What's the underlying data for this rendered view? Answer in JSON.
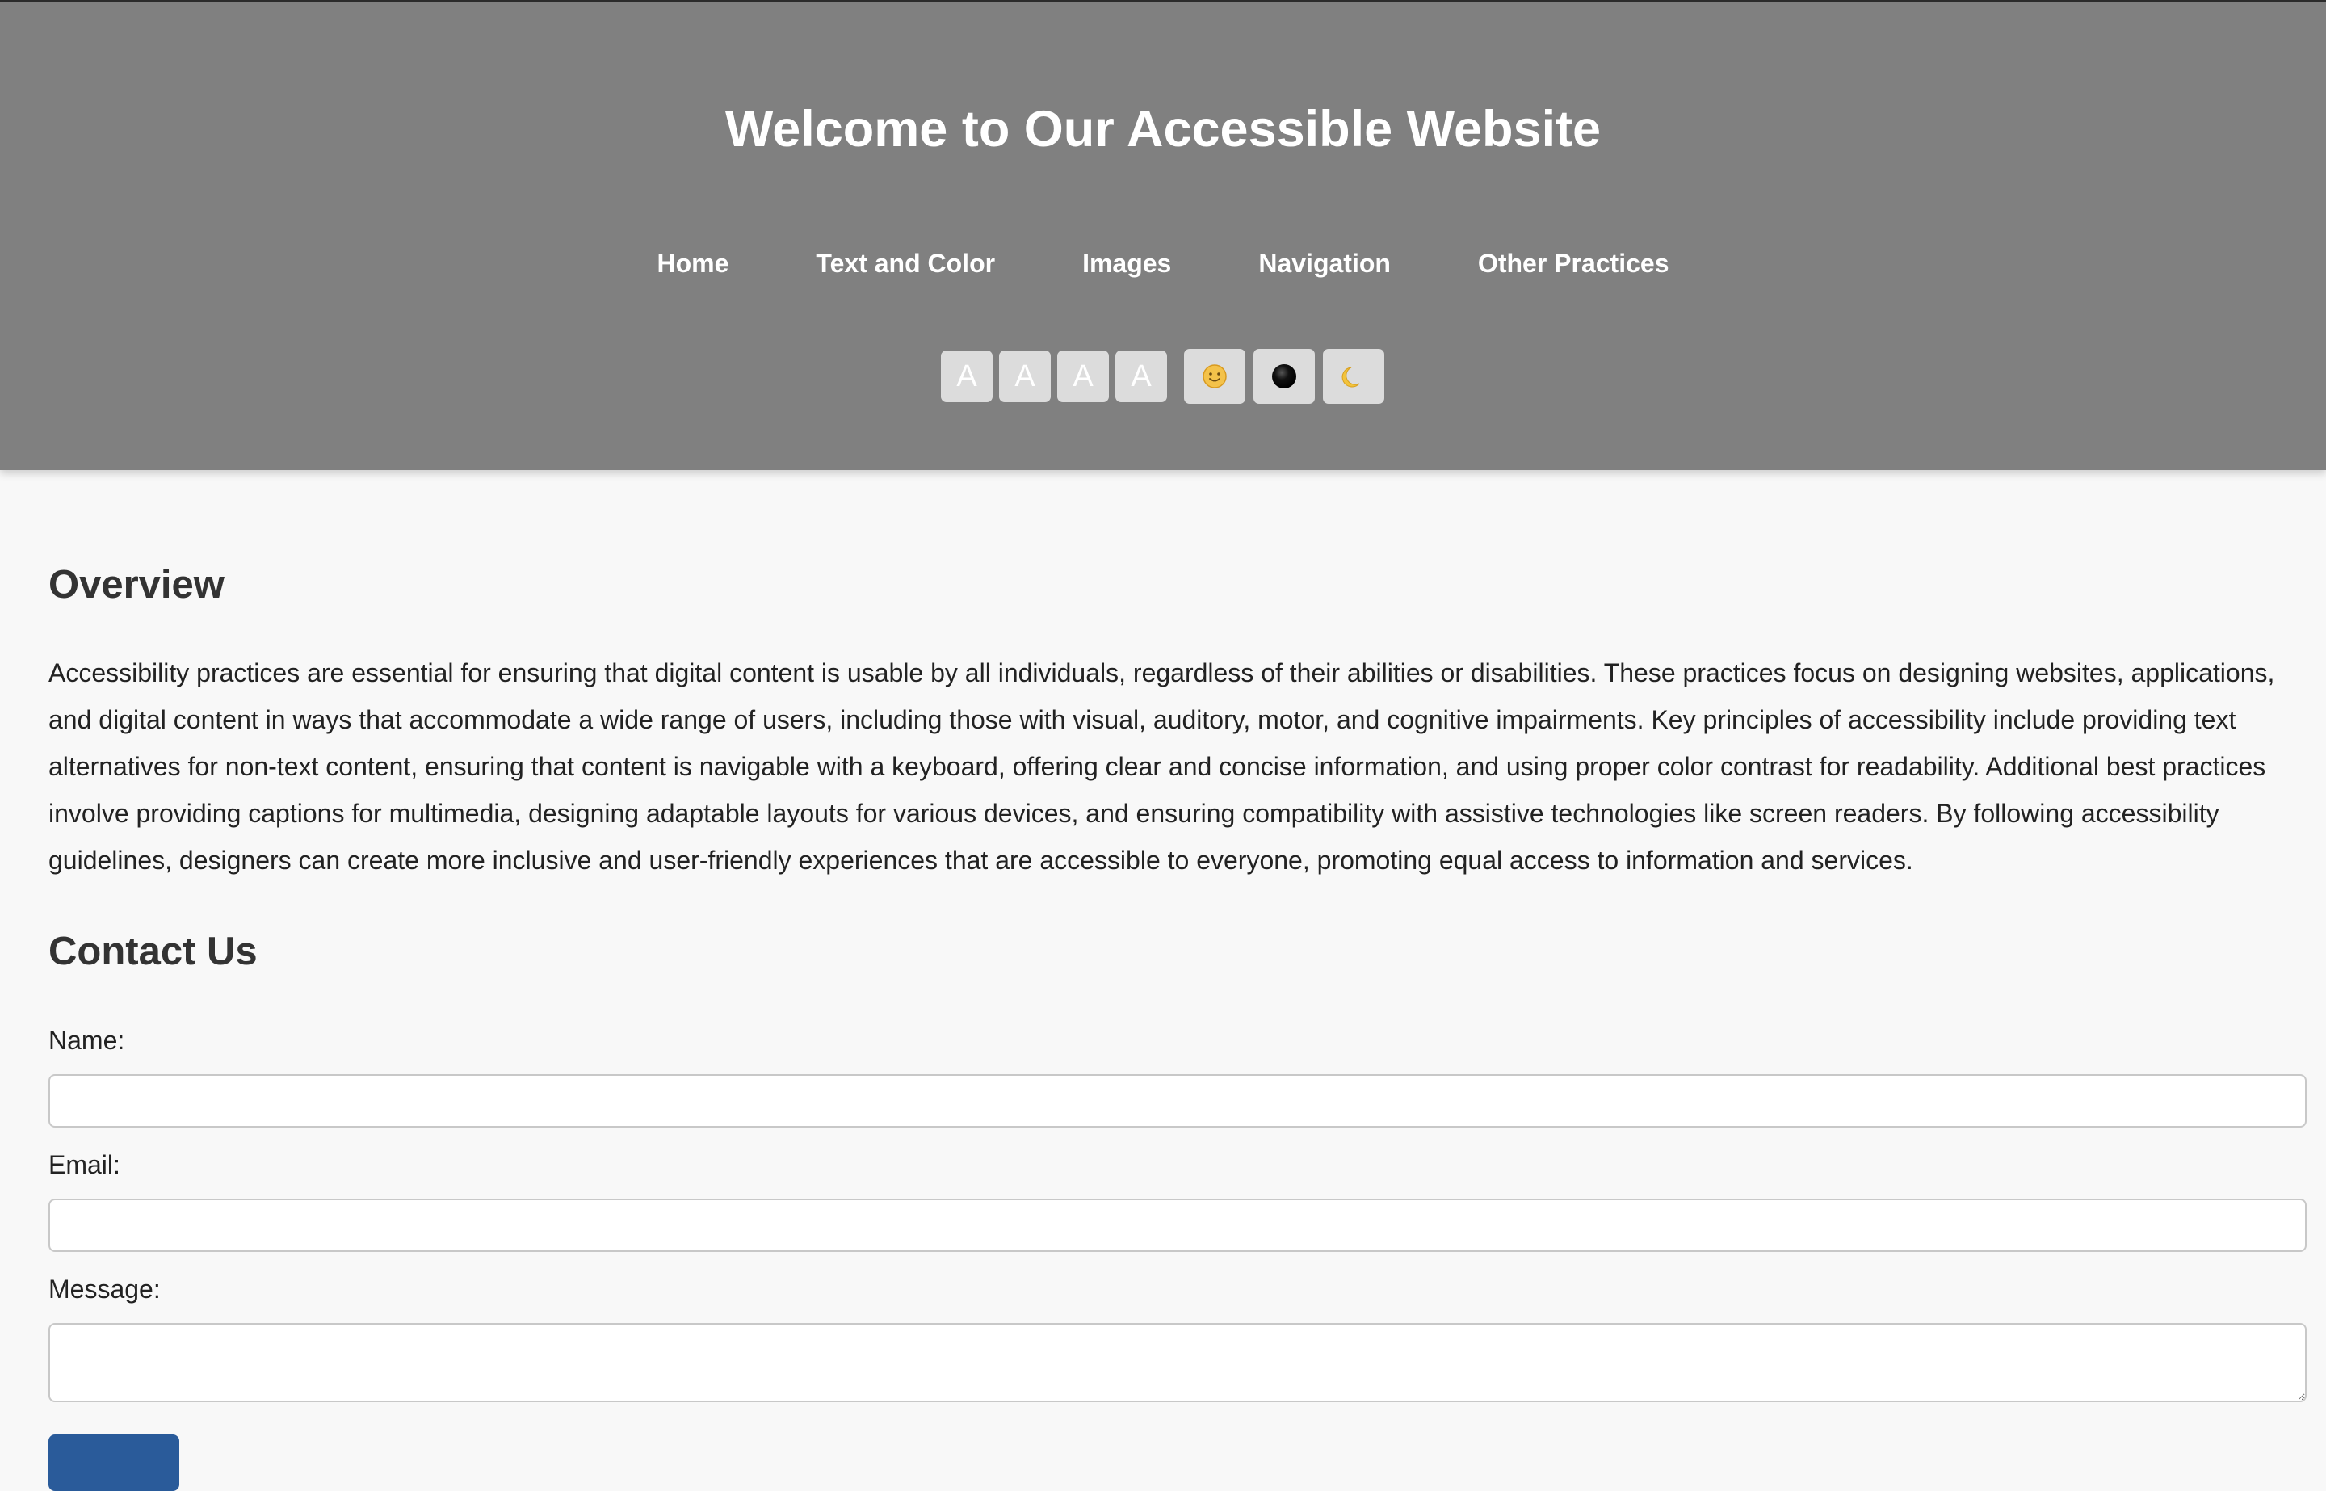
{
  "header": {
    "title": "Welcome to Our Accessible Website",
    "nav": [
      {
        "label": "Home"
      },
      {
        "label": "Text and Color"
      },
      {
        "label": "Images"
      },
      {
        "label": "Navigation"
      },
      {
        "label": "Other Practices"
      }
    ],
    "font_size_buttons": [
      "A",
      "A",
      "A",
      "A"
    ],
    "mode_buttons": [
      {
        "icon": "smiley-icon"
      },
      {
        "icon": "contrast-circle-icon"
      },
      {
        "icon": "crescent-moon-icon"
      }
    ]
  },
  "overview": {
    "title": "Overview",
    "text": "Accessibility practices are essential for ensuring that digital content is usable by all individuals, regardless of their abilities or disabilities. These practices focus on designing websites, applications, and digital content in ways that accommodate a wide range of users, including those with visual, auditory, motor, and cognitive impairments. Key principles of accessibility include providing text alternatives for non-text content, ensuring that content is navigable with a keyboard, offering clear and concise information, and using proper color contrast for readability. Additional best practices involve providing captions for multimedia, designing adaptable layouts for various devices, and ensuring compatibility with assistive technologies like screen readers. By following accessibility guidelines, designers can create more inclusive and user-friendly experiences that are accessible to everyone, promoting equal access to information and services."
  },
  "contact": {
    "title": "Contact Us",
    "name_label": "Name:",
    "name_value": "",
    "email_label": "Email:",
    "email_value": "",
    "message_label": "Message:",
    "message_value": "",
    "submit_label": ""
  },
  "colors": {
    "header_bg": "#808080",
    "page_bg": "#f8f8f8",
    "button_bg": "#dcdcdc",
    "submit_bg": "#2a5b9a"
  }
}
